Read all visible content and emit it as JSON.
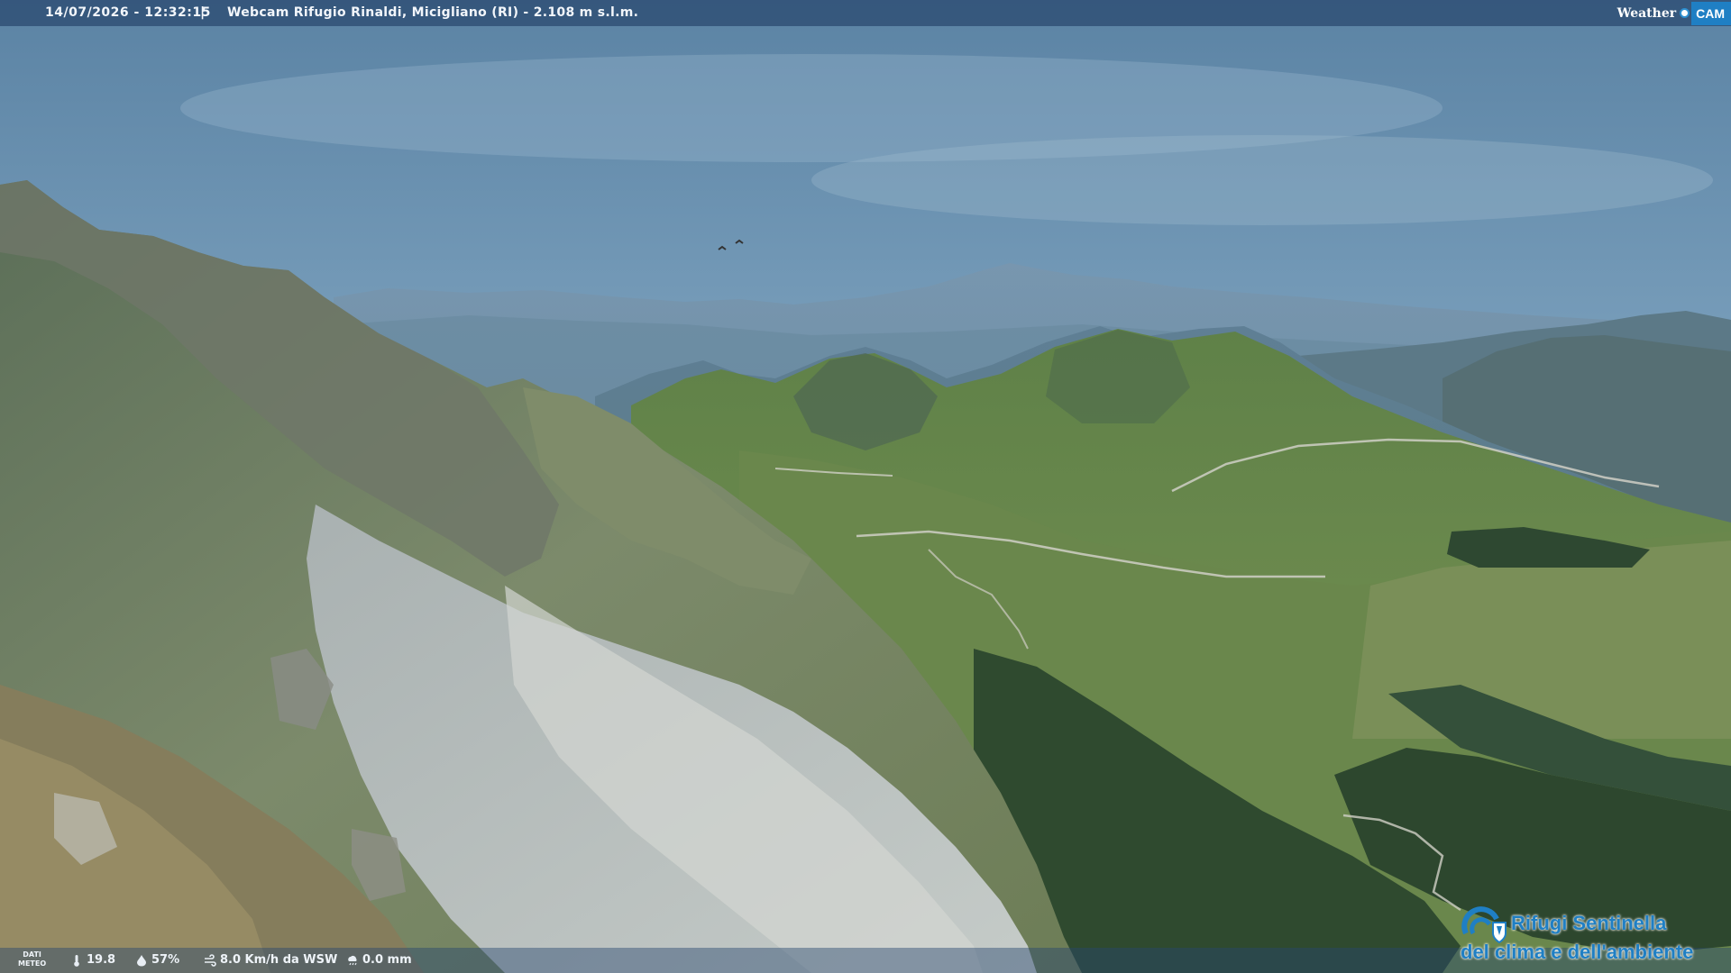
{
  "overlay": {
    "timestamp": "14/07/2026 - 12:32:15",
    "separator": "|",
    "title": "Webcam Rifugio Rinaldi, Micigliano (RI) - 2.108 m s.l.m."
  },
  "brand": {
    "weather": "Weather",
    "cam": "CAM",
    "accent": "#1f7fc4"
  },
  "meteo": {
    "label_line1": "DATI",
    "label_line2": "METEO",
    "temperature": "19.8",
    "humidity": "57%",
    "wind": "8.0 Km/h da WSW",
    "rain": "0.0 mm"
  },
  "sponsor": {
    "line1": "Rifugi Sentinella",
    "line2": "del clima e dell'ambiente"
  },
  "icons": {
    "temperature": "thermometer-icon",
    "humidity": "humidity-drop-icon",
    "wind": "wind-icon",
    "rain": "rain-cloud-icon"
  }
}
